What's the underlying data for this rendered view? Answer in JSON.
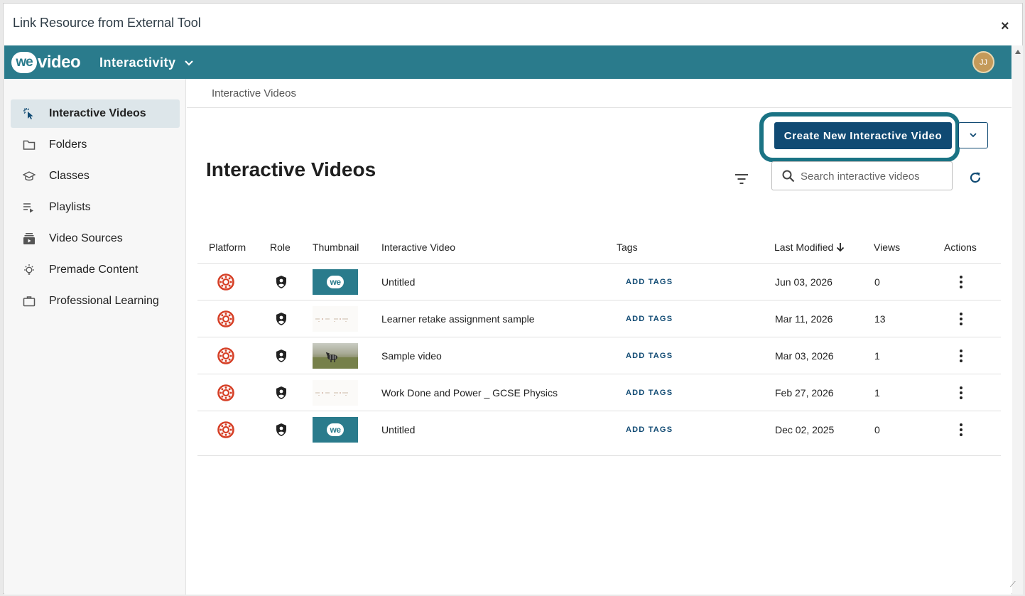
{
  "dialog": {
    "title": "Link Resource from External Tool",
    "close_label": "×"
  },
  "topbar": {
    "logo_we": "we",
    "logo_video": "video",
    "app_name": "Interactivity",
    "user_initials": "JJ"
  },
  "sidebar": {
    "items": [
      {
        "label": "Interactive Videos",
        "icon": "cursor-click-icon",
        "active": true
      },
      {
        "label": "Folders",
        "icon": "folder-icon"
      },
      {
        "label": "Classes",
        "icon": "graduation-cap-icon"
      },
      {
        "label": "Playlists",
        "icon": "playlist-icon"
      },
      {
        "label": "Video Sources",
        "icon": "video-library-icon"
      },
      {
        "label": "Premade Content",
        "icon": "lightbulb-icon"
      },
      {
        "label": "Professional Learning",
        "icon": "briefcase-icon"
      }
    ]
  },
  "main": {
    "breadcrumb": "Interactive Videos",
    "create_button": "Create New Interactive Video",
    "page_title": "Interactive Videos",
    "search_placeholder": "Search interactive videos"
  },
  "table": {
    "columns": {
      "platform": "Platform",
      "role": "Role",
      "thumbnail": "Thumbnail",
      "interactive_video": "Interactive Video",
      "tags": "Tags",
      "last_modified": "Last Modified",
      "views": "Views",
      "actions": "Actions"
    },
    "add_tags_label": "ADD TAGS",
    "rows": [
      {
        "title": "Untitled",
        "date": "Jun 03, 2026",
        "views": "0",
        "thumb": "we"
      },
      {
        "title": "Learner retake assignment sample",
        "date": "Mar 11, 2026",
        "views": "13",
        "thumb": "doc"
      },
      {
        "title": "Sample video",
        "date": "Mar 03, 2026",
        "views": "1",
        "thumb": "photo"
      },
      {
        "title": "Work Done and Power _ GCSE Physics",
        "date": "Feb 27, 2026",
        "views": "1",
        "thumb": "doc"
      },
      {
        "title": "Untitled",
        "date": "Dec 02, 2025",
        "views": "0",
        "thumb": "we"
      }
    ]
  },
  "colors": {
    "brand_teal": "#2a7b8c",
    "primary_blue": "#104a73",
    "canvas_red": "#d64027"
  }
}
